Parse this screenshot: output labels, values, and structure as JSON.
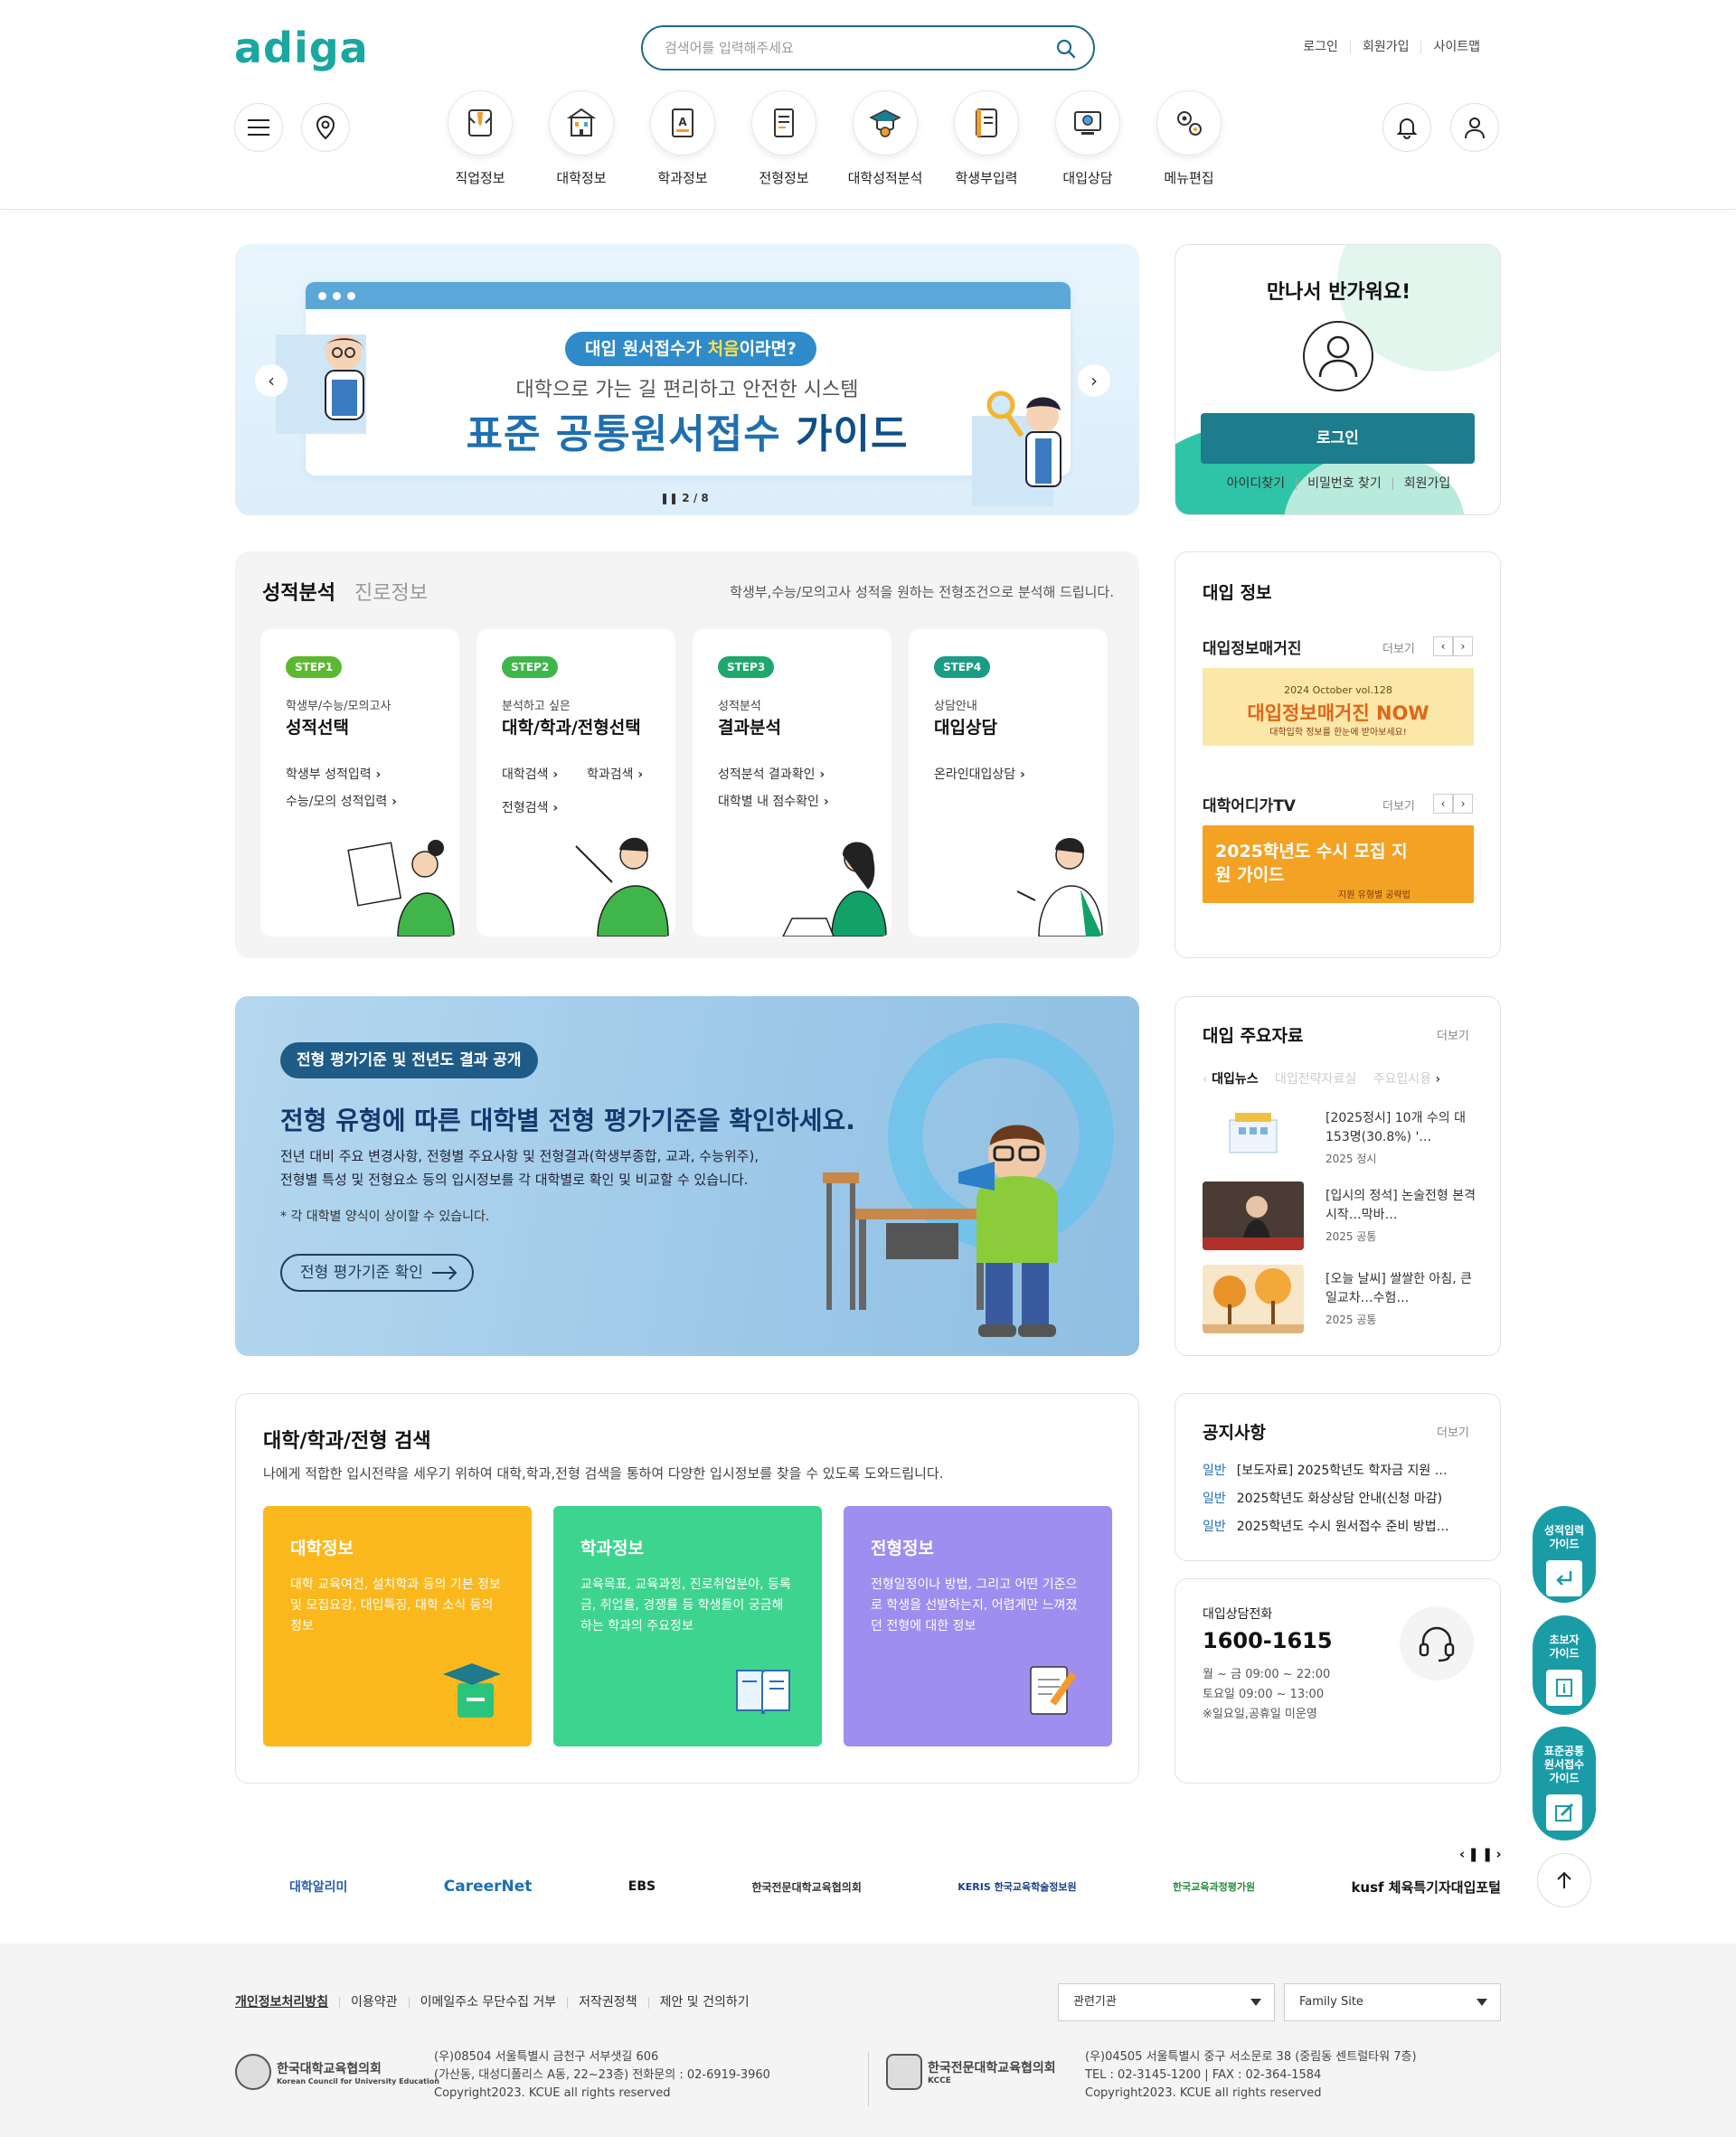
{
  "header": {
    "logo": "adiga",
    "search_placeholder": "검색어를 입력해주세요",
    "top_links": [
      "로그인",
      "회원가입",
      "사이트맵"
    ],
    "nav": [
      {
        "label": "직업정보",
        "icon": "job-icon"
      },
      {
        "label": "대학정보",
        "icon": "university-icon"
      },
      {
        "label": "학과정보",
        "icon": "major-icon"
      },
      {
        "label": "전형정보",
        "icon": "admission-type-icon"
      },
      {
        "label": "대학성적분석",
        "icon": "grade-analysis-icon"
      },
      {
        "label": "학생부입력",
        "icon": "record-input-icon"
      },
      {
        "label": "대입상담",
        "icon": "counseling-icon"
      },
      {
        "label": "메뉴편집",
        "icon": "menu-edit-icon"
      }
    ]
  },
  "hero": {
    "pill_prefix": "대입 원서접수가 ",
    "pill_em": "처음",
    "pill_suffix": "이라면?",
    "sub": "대학으로 가는 길 편리하고 안전한 시스템",
    "title_main": "표준 공통원서접수 ",
    "title_bold": "가이드",
    "pager": "2 / 8"
  },
  "login": {
    "greeting": "만나서 반가워요!",
    "button": "로그인",
    "links": [
      "아이디찾기",
      "비밀번호 찾기",
      "회원가입"
    ]
  },
  "grade": {
    "tab_active": "성적분석",
    "tab_inactive": "진로정보",
    "description": "학생부,수능/모의고사 성적을 원하는 전형조건으로 분석해 드립니다.",
    "steps": [
      {
        "badge": "STEP1",
        "small": "학생부/수능/모의고사",
        "big": "성적선택",
        "links": [
          "학생부 성적입력",
          "수능/모의 성적입력"
        ],
        "color": "#5cb82f"
      },
      {
        "badge": "STEP2",
        "small": "분석하고 싶은",
        "big": "대학/학과/전형선택",
        "links": [
          "대학검색",
          "학과검색",
          "전형검색"
        ],
        "color": "#3db64a"
      },
      {
        "badge": "STEP3",
        "small": "성적분석",
        "big": "결과분석",
        "links": [
          "성적분석 결과확인",
          "대학별 내 점수확인"
        ],
        "color": "#1ea86c"
      },
      {
        "badge": "STEP4",
        "small": "상담안내",
        "big": "대입상담",
        "links": [
          "온라인대입상담"
        ],
        "color": "#1b9c86"
      }
    ]
  },
  "admission_info": {
    "title": "대입 정보",
    "magazine_title": "대입정보매거진",
    "magazine_more": "더보기",
    "magazine_banner_top": "2024 October vol.128",
    "magazine_banner_main": "대입정보매거진 NOW",
    "magazine_banner_sub": "대학입학 정보를 한눈에 받아보세요!",
    "tv_title": "대학어디가TV",
    "tv_more": "더보기",
    "tv_banner_main": "2025학년도 수시 모집 지원 가이드",
    "tv_banner_sub": "지원 유형별 공략법"
  },
  "eval": {
    "tag": "전형 평가기준 및 전년도 결과 공개",
    "headline": "전형 유형에 따른 대학별 전형 평가기준을 확인하세요.",
    "p1": "전년 대비 주요 변경사항, 전형별 주요사항 및 전형결과(학생부종합, 교과, 수능위주),",
    "p2": "전형별 특성 및 전형요소 등의 입시정보를 각 대학별로 확인 및 비교할 수 있습니다.",
    "note": "* 각 대학별 양식이 상이할 수 있습니다.",
    "button": "전형 평가기준 확인"
  },
  "materials": {
    "title": "대입 주요자료",
    "more": "더보기",
    "tabs": [
      "대입뉴스",
      "대입전략자료실",
      "주요입시용"
    ],
    "items": [
      {
        "title": "[2025정시] 10개 수의 대 153명(30.8%) '…",
        "meta": "2025 정시"
      },
      {
        "title": "[입시의 정석] 논술전형 본격 시작…막바…",
        "meta": "2025 공통"
      },
      {
        "title": "[오늘 날씨] 쌀쌀한 아침, 큰 일교차…수험…",
        "meta": "2025 공통"
      }
    ]
  },
  "search_section": {
    "title": "대학/학과/전형 검색",
    "description": "나에게 적합한 입시전략을 세우기 위하여 대학,학과,전형 검색을 통하여 다양한 입시정보를 찾을 수 있도록 도와드립니다.",
    "boxes": [
      {
        "title": "대학정보",
        "desc": "대학 교육여건, 설치학과 등의 기본 정보 및 모집요강, 대입특징, 대학 소식 등의 정보",
        "color": "#fbb81c"
      },
      {
        "title": "학과정보",
        "desc": "교육목표, 교육과정, 진로취업분야, 등록금, 취업률, 경쟁률 등 학생들이 궁금해 하는 학과의 주요정보",
        "color": "#3dd48f"
      },
      {
        "title": "전형정보",
        "desc": "전형일정이나 방법, 그리고 어떤 기준으로 학생을 선발하는지, 어렵게만 느껴졌던 전형에 대한 정보",
        "color": "#9d8ef0"
      }
    ]
  },
  "notice": {
    "title": "공지사항",
    "more": "더보기",
    "items": [
      {
        "cat": "일반",
        "text": "[보도자료] 2025학년도 학자금 지원 …"
      },
      {
        "cat": "일반",
        "text": "2025학년도 화상상담 안내(신청 마감)"
      },
      {
        "cat": "일반",
        "text": "2025학년도 수시 원서접수 준비 방법…"
      }
    ]
  },
  "call": {
    "label": "대입상담전화",
    "number": "1600-1615",
    "hours1": "월 ~ 금 09:00 ~ 22:00",
    "hours2": "토요일 09:00 ~ 13:00",
    "hours3": "※일요일,공휴일 미운영"
  },
  "floating": [
    {
      "l1": "성적입력",
      "l2": "가이드",
      "icon": "enter-icon"
    },
    {
      "l1": "초보자",
      "l2": "가이드",
      "icon": "info-icon"
    },
    {
      "l1": "표준공통",
      "l2": "원서접수",
      "l3": "가이드",
      "icon": "edit-icon"
    }
  ],
  "partners": [
    "대학알리미",
    "CareerNet",
    "EBS",
    "한국전문대학교육협의회",
    "KERIS 한국교육학술정보원",
    "한국교육과정평가원",
    "kusf 체육특기자대입포털"
  ],
  "footer": {
    "links": [
      "개인정보처리방침",
      "이용약관",
      "이메일주소 무단수집 거부",
      "저작권정책",
      "제안 및 건의하기"
    ],
    "select1": "관련기관",
    "select2": "Family Site",
    "org1_name": "한국대학교육협의회",
    "org1_sub": "Korean Council for University Education",
    "org1_l1": "(우)08504 서울특별시 금천구 서부샛길 606",
    "org1_l2": "(가산동, 대성디폴리스 A동, 22~23층) 전화문의 : 02-6919-3960",
    "org1_l3": "Copyright2023. KCUE all rights reserved",
    "org2_name": "한국전문대학교육협의회",
    "org2_sub": "KCCE",
    "org2_l1": "(우)04505 서울특별시 중구 서소문로 38 (중림동 센트럴타워 7층)",
    "org2_l2": "TEL : 02-3145-1200 | FAX : 02-364-1584",
    "org2_l3": "Copyright2023. KCUE all rights reserved"
  },
  "colors": {
    "accent": "#1d7d8c",
    "brand": "#1aa7a0",
    "link": "#1c72b8"
  }
}
